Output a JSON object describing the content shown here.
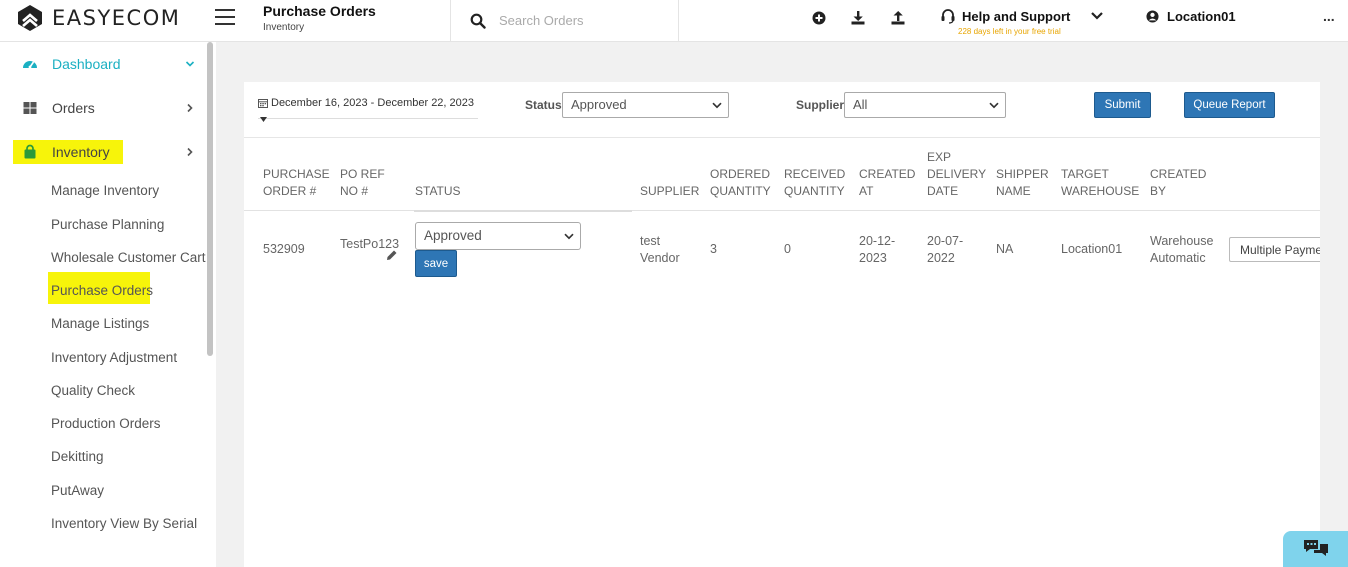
{
  "header": {
    "logo_text": "EASYECOM",
    "page_title": "Purchase Orders",
    "page_subtitle": "Inventory",
    "search_placeholder": "Search Orders",
    "help_label": "Help and Support",
    "trial_text": "228 days left in your free trial",
    "location_label": "Location01",
    "more_label": "..."
  },
  "sidebar": {
    "main": [
      {
        "label": "Dashboard",
        "icon": "speedometer-icon"
      },
      {
        "label": "Orders",
        "icon": "grid-icon"
      },
      {
        "label": "Inventory",
        "icon": "bag-icon"
      }
    ],
    "sub": [
      "Manage Inventory",
      "Purchase Planning",
      "Wholesale Customer Cart",
      "Purchase Orders",
      "Manage Listings",
      "Inventory Adjustment",
      "Quality Check",
      "Production Orders",
      "Dekitting",
      "PutAway",
      "Inventory View By Serial"
    ]
  },
  "filters": {
    "date_range": "December 16, 2023 - December 22, 2023",
    "status_label": "Status",
    "status_value": "Approved",
    "supplier_label": "Supplier",
    "supplier_value": "All",
    "submit_label": "Submit",
    "queue_label": "Queue Report"
  },
  "table": {
    "headers": {
      "po_no": [
        "PURCHASE",
        "ORDER #"
      ],
      "po_ref": [
        "PO REF",
        "NO #"
      ],
      "status": [
        "STATUS"
      ],
      "supplier": [
        "SUPPLIER"
      ],
      "ordered": [
        "ORDERED",
        "QUANTITY"
      ],
      "received": [
        "RECEIVED",
        "QUANTITY"
      ],
      "created_at": [
        "CREATED",
        "AT"
      ],
      "exp": [
        "EXP",
        "DELIVERY",
        "DATE"
      ],
      "shipper": [
        "SHIPPER",
        "NAME"
      ],
      "warehouse": [
        "TARGET",
        "WAREHOUSE"
      ],
      "created_by": [
        "CREATED",
        "BY"
      ]
    },
    "row": {
      "po_no": "532909",
      "po_ref": "TestPo123",
      "status": "Approved",
      "save_label": "save",
      "supplier": [
        "test",
        "Vendor"
      ],
      "ordered": "3",
      "received": "0",
      "created_at": [
        "20-12-",
        "2023"
      ],
      "exp": [
        "20-07-",
        "2022"
      ],
      "shipper": "NA",
      "warehouse": "Location01",
      "created_by": [
        "Warehouse",
        "Automatic"
      ],
      "payment": "Multiple Payments"
    }
  },
  "colors": {
    "accent": "#1bb0c2",
    "primary_button": "#2e76b5",
    "highlight": "#f7f40a",
    "trial_text": "#e8a500",
    "chat_widget": "#7fd3ec"
  }
}
